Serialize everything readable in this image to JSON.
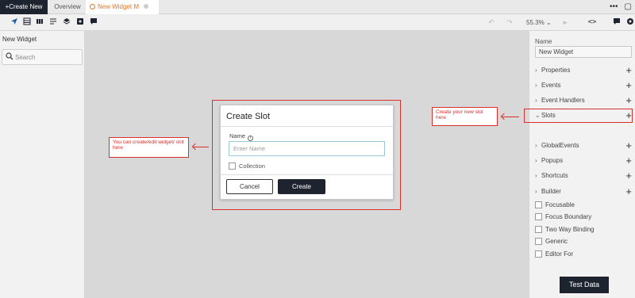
{
  "tabbar": {
    "create_new": "+Create New",
    "tabs": [
      {
        "label": "Overview"
      },
      {
        "label": "New Widget M"
      }
    ],
    "more": "•••",
    "chat": "▢"
  },
  "toolbar": {
    "zoom": "55.3% ⌄"
  },
  "left_panel": {
    "title": "New Widget",
    "search_placeholder": "Search"
  },
  "right_panel": {
    "name_label": "Name",
    "name_value": "New Widget",
    "sections": [
      {
        "label": "Properties",
        "expanded": false
      },
      {
        "label": "Events",
        "expanded": false
      },
      {
        "label": "Event Handlers",
        "expanded": false
      },
      {
        "label": "Slots",
        "expanded": true
      },
      {
        "label": "GlobalEvents",
        "expanded": false
      },
      {
        "label": "Popups",
        "expanded": false
      },
      {
        "label": "Shortcuts",
        "expanded": false
      },
      {
        "label": "Builder",
        "expanded": false
      }
    ],
    "checkboxes": [
      {
        "label": "Focusable",
        "checked": false
      },
      {
        "label": "Focus Boundary",
        "checked": false
      },
      {
        "label": "Two Way Binding",
        "checked": false
      },
      {
        "label": "Generic",
        "checked": false
      },
      {
        "label": "Editor For",
        "checked": false
      }
    ],
    "test_data": "Test Data"
  },
  "dialog": {
    "title": "Create Slot",
    "name_label": "Name",
    "info_glyph": "i",
    "placeholder": "Enter Name",
    "collection_label": "Collection",
    "cancel": "Cancel",
    "create": "Create"
  },
  "annotations": {
    "left_note": "You can create/edit widget/ slot here",
    "right_note": "Create your new slot here"
  },
  "colors": {
    "dark": "#1e2330",
    "accent": "#e0762b",
    "annotation": "#d9302c"
  }
}
